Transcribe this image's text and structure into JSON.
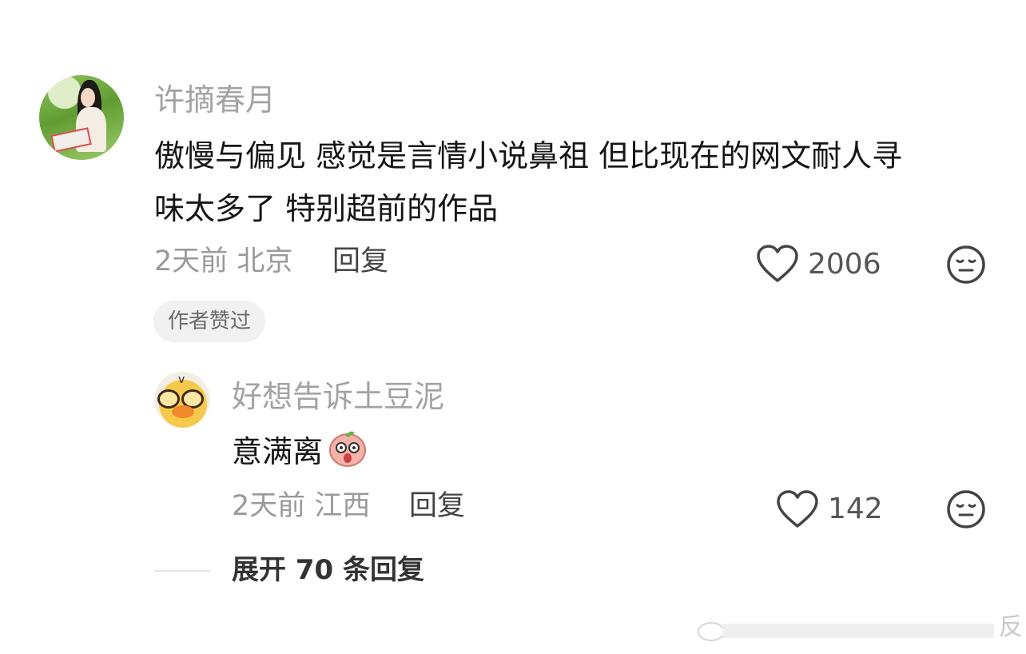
{
  "comment": {
    "username": "许摘春月",
    "line1": "傲慢与偏见 感觉是言情小说鼻祖 但比现在的网文耐人寻",
    "line2": "味太多了 特别超前的作品",
    "time_location": "2天前 北京",
    "reply_label": "回复",
    "likes": "2006",
    "badge": "作者赞过"
  },
  "reply": {
    "username": "好想告诉土豆泥",
    "text": "意满离",
    "emoji": "peach-face-emoji",
    "time_location": "2天前 江西",
    "reply_label": "回复",
    "likes": "142"
  },
  "expand_label": "展开 70 条回复",
  "watermark": "反",
  "icons": {
    "like": "heart-outline-icon",
    "dislike": "neutral-face-icon"
  },
  "colors": {
    "username": "#a3a3a3",
    "text": "#161616",
    "meta": "#9a9a9a",
    "icon": "#444444"
  }
}
